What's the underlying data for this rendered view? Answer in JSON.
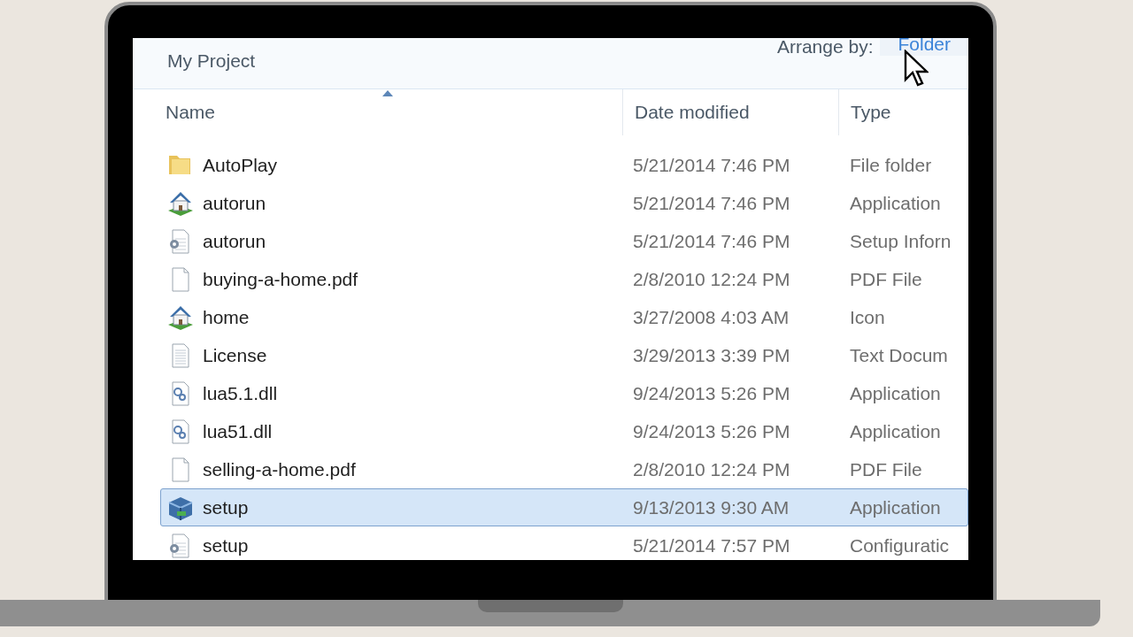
{
  "toolbar": {
    "location": "My Project",
    "arrange_label": "Arrange by:",
    "arrange_value": "Folder"
  },
  "columns": [
    {
      "label": "Name",
      "sorted": true
    },
    {
      "label": "Date modified",
      "sorted": false
    },
    {
      "label": "Type",
      "sorted": false
    }
  ],
  "rows": [
    {
      "kind": "folder",
      "name": "AutoPlay",
      "date": "5/21/2014 7:46 PM",
      "type": "File folder",
      "selected": false
    },
    {
      "kind": "house",
      "name": "autorun",
      "date": "5/21/2014 7:46 PM",
      "type": "Application",
      "selected": false
    },
    {
      "kind": "config",
      "name": "autorun",
      "date": "5/21/2014 7:46 PM",
      "type": "Setup Inforn",
      "selected": false
    },
    {
      "kind": "document",
      "name": "buying-a-home.pdf",
      "date": "2/8/2010 12:24 PM",
      "type": "PDF File",
      "selected": false
    },
    {
      "kind": "house",
      "name": "home",
      "date": "3/27/2008 4:03 AM",
      "type": "Icon",
      "selected": false
    },
    {
      "kind": "text",
      "name": "License",
      "date": "3/29/2013 3:39 PM",
      "type": "Text Docum",
      "selected": false
    },
    {
      "kind": "dll",
      "name": "lua5.1.dll",
      "date": "9/24/2013 5:26 PM",
      "type": "Application",
      "selected": false
    },
    {
      "kind": "dll",
      "name": "lua51.dll",
      "date": "9/24/2013 5:26 PM",
      "type": "Application",
      "selected": false
    },
    {
      "kind": "document",
      "name": "selling-a-home.pdf",
      "date": "2/8/2010 12:24 PM",
      "type": "PDF File",
      "selected": false
    },
    {
      "kind": "installer",
      "name": "setup",
      "date": "9/13/2013 9:30 AM",
      "type": "Application",
      "selected": true
    },
    {
      "kind": "config",
      "name": "setup",
      "date": "5/21/2014 7:57 PM",
      "type": "Configuratic",
      "selected": false
    }
  ]
}
